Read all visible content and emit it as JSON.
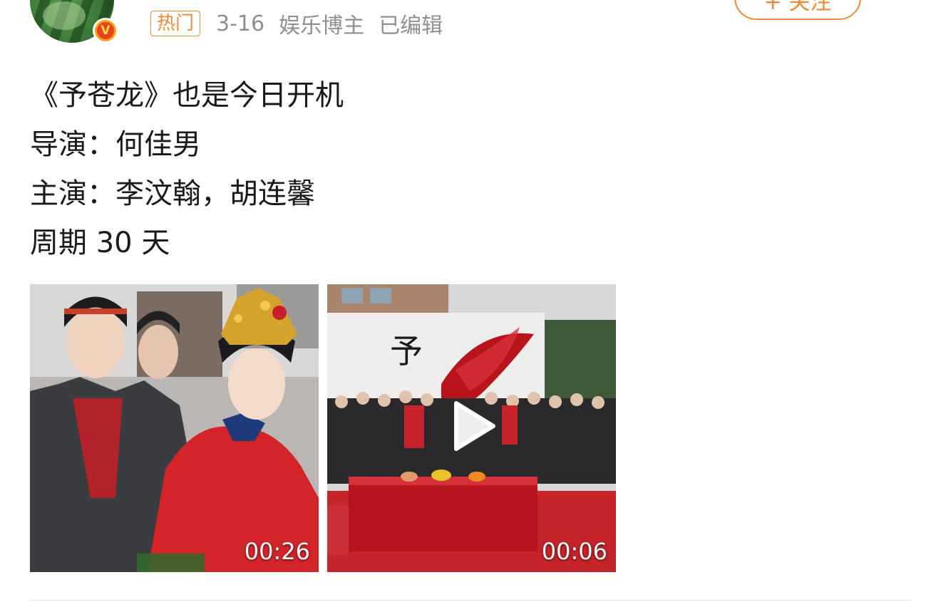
{
  "header": {
    "hot_tag": "热门",
    "date": "3-16",
    "author_type": "娱乐博主",
    "edited": "已编辑",
    "follow_label": "+ 关注",
    "verified_mark": "V"
  },
  "post": {
    "lines": [
      "《予苍龙》也是今日开机",
      "导演：何佳男",
      "主演：李汶翰，胡连馨",
      "周期 30 天"
    ]
  },
  "videos": [
    {
      "duration": "00:26",
      "icon": "video-thumbnail"
    },
    {
      "duration": "00:06",
      "icon": "play-icon"
    }
  ],
  "colors": {
    "accent": "#ee8a33",
    "meta_text": "#8f8f8f",
    "body_text": "#1a1a1a",
    "verified": "#f7a31c"
  }
}
